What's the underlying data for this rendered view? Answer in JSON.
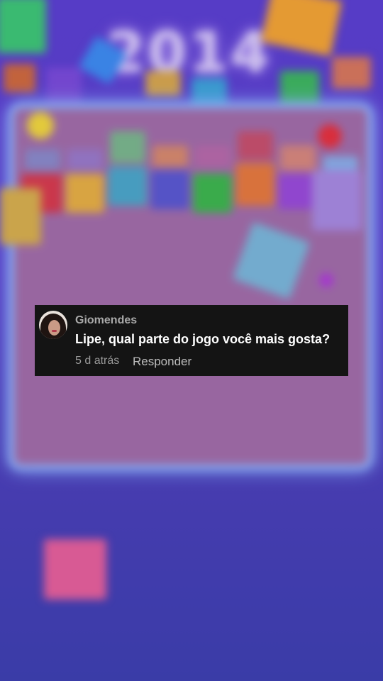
{
  "background": {
    "title": "2014",
    "board_color": "#a26da7",
    "border_color": "#8fb7ff"
  },
  "comment": {
    "username": "Giomendes",
    "text": "Lipe, qual parte do jogo você mais gosta?",
    "timestamp": "5 d atrás",
    "reply_label": "Responder",
    "avatar_icon": "profile-photo"
  }
}
